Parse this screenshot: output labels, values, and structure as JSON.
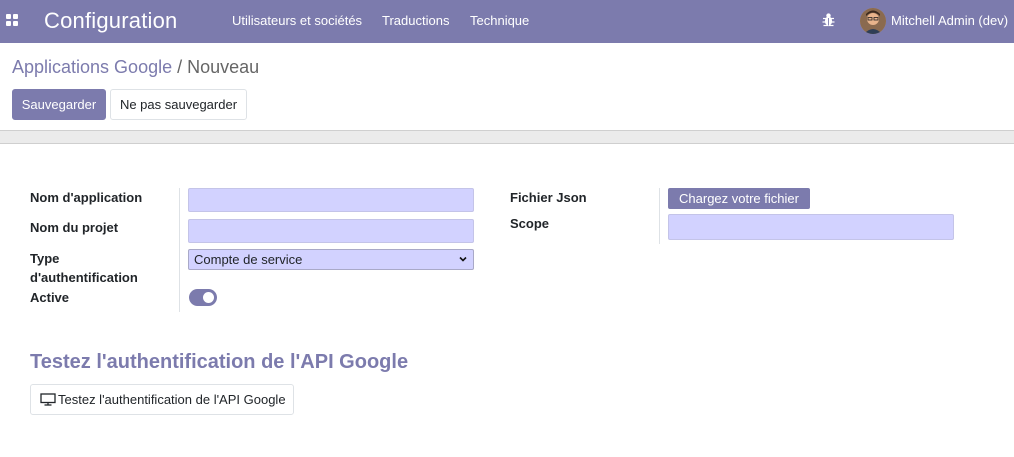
{
  "navbar": {
    "app_title": "Configuration",
    "menu": [
      "Utilisateurs et sociétés",
      "Traductions",
      "Technique"
    ],
    "user_name": "Mitchell Admin (dev)",
    "icons": [
      "apps-icon",
      "bug-icon",
      "avatar"
    ]
  },
  "breadcrumb": {
    "parent": "Applications Google",
    "separator": "/",
    "current": "Nouveau"
  },
  "actions": {
    "save_label": "Sauvegarder",
    "discard_label": "Ne pas sauvegarder"
  },
  "form": {
    "left": {
      "app_name_label": "Nom d'application",
      "app_name_value": "",
      "project_name_label": "Nom du projet",
      "project_name_value": "",
      "auth_type_label_line1": "Type",
      "auth_type_label_line2": "d'authentification",
      "auth_type_value": "Compte de service",
      "active_label": "Active",
      "active_value": true
    },
    "right": {
      "json_file_label": "Fichier Json",
      "upload_label": "Chargez votre fichier",
      "scope_label": "Scope",
      "scope_value": ""
    }
  },
  "test_section": {
    "title": "Testez l'authentification de l'API Google",
    "button_label": "Testez l'authentification de l'API Google"
  },
  "colors": {
    "brand": "#7c7bad",
    "required_field": "#d2d2ff"
  }
}
